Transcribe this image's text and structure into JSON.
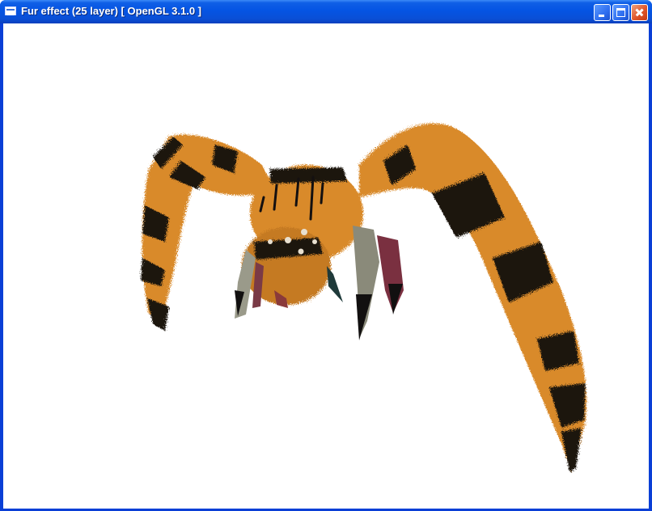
{
  "window": {
    "title": "Fur effect (25 layer) [ OpenGL 3.1.0 ]",
    "controls": [
      "minimize",
      "maximize",
      "close"
    ]
  },
  "colors": {
    "titlebar": "#0554e3",
    "viewport_background": "#ffffff",
    "fur_orange": "#d98a2b",
    "fur_black": "#1a1410"
  },
  "scene": {
    "icons": [
      "app-window-icon",
      "minimize-icon",
      "maximize-icon",
      "close-icon"
    ]
  }
}
